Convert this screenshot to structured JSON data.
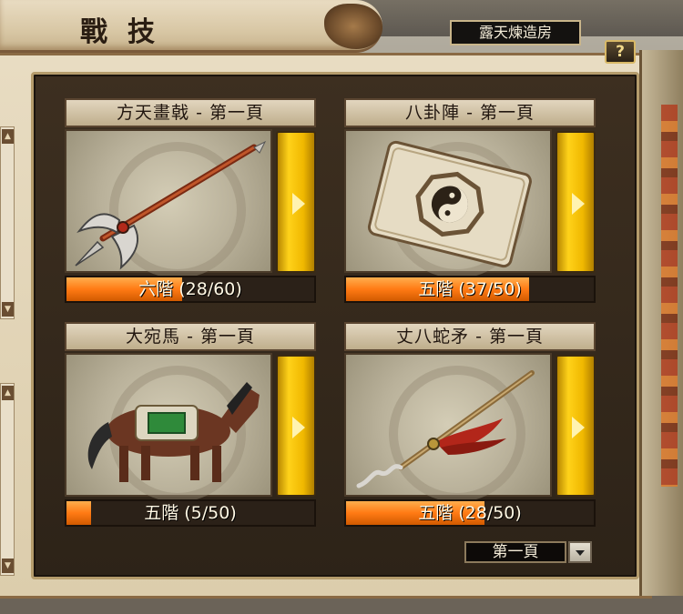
{
  "header": {
    "title": "戰技",
    "location": "露天煉造房",
    "help_label": "?"
  },
  "cards": [
    {
      "title": "方天畫戟 - 第一頁",
      "level": "六階 (28/60)",
      "progress": 0.467,
      "image": "halberd"
    },
    {
      "title": "八卦陣 - 第一頁",
      "level": "五階 (37/50)",
      "progress": 0.74,
      "image": "bagua-scroll"
    },
    {
      "title": "大宛馬 - 第一頁",
      "level": "五階 (5/50)",
      "progress": 0.1,
      "image": "horse"
    },
    {
      "title": "丈八蛇矛 - 第一頁",
      "level": "五階 (28/50)",
      "progress": 0.56,
      "image": "serpent-spear"
    }
  ],
  "pager": {
    "selected": "第一頁"
  },
  "colors": {
    "frame": "#2d2318",
    "progress": "#ff7a14",
    "next_button": "#ffd21a"
  }
}
